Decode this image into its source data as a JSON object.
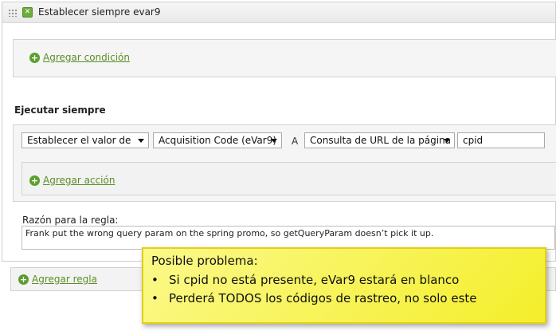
{
  "rule": {
    "title": "Establecer siempre evar9",
    "header_icon": "x-icon"
  },
  "conditions": {
    "add_label": "Agregar condición"
  },
  "actions": {
    "section_label": "Ejecutar siempre",
    "set_value_select": "Establecer el valor de",
    "variable_select": "Acquisition Code (eVar9)",
    "to_label": "A",
    "source_select": "Consulta de URL de la página",
    "param_value": "cpid",
    "add_label": "Agregar acción"
  },
  "reason": {
    "label": "Razón para la regla:",
    "text": "Frank put the wrong query param on the spring promo, so getQueryParam doesn’t pick it up."
  },
  "add_rule_label": "Agregar regla",
  "callout": {
    "title": "Posible problema:",
    "items": [
      "Si cpid no está presente, eVar9 estará en blanco",
      "Perderá TODOS los códigos de rastreo, no solo este"
    ],
    "bullet": "•"
  },
  "colors": {
    "accent_green": "#5aa02c",
    "callout_yellow": "#f4ee2a"
  }
}
